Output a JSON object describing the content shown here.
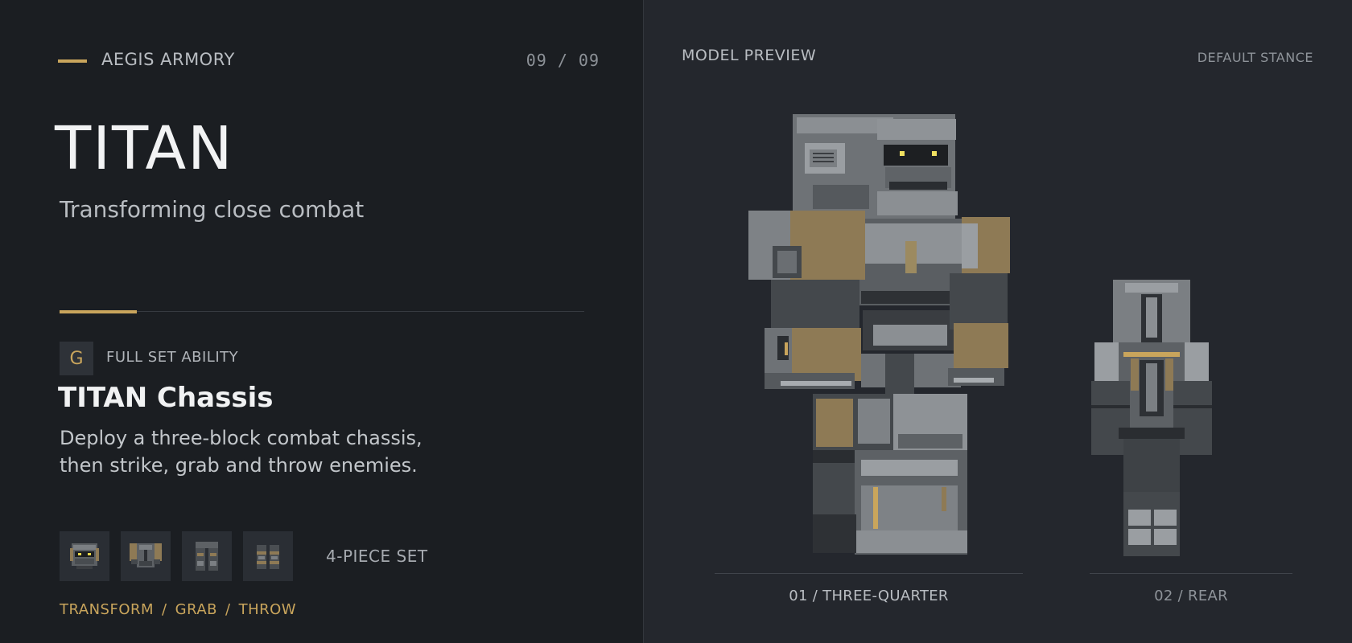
{
  "header": {
    "brand": "AEGIS ARMORY",
    "counter": "09 / 09"
  },
  "hero": {
    "title": "TITAN",
    "subtitle": "Transforming close combat"
  },
  "ability": {
    "key": "G",
    "caption": "FULL SET ABILITY",
    "name": "TITAN Chassis",
    "description": "Deploy a three-block combat chassis, then strike, grab and throw enemies."
  },
  "set": {
    "pieces": [
      "helmet-icon",
      "chestplate-icon",
      "leggings-icon",
      "boots-icon"
    ],
    "label": "4-PIECE SET"
  },
  "tags": [
    "TRANSFORM",
    "GRAB",
    "THROW"
  ],
  "tag_separator": "/",
  "preview": {
    "title": "MODEL PREVIEW",
    "stance": "DEFAULT STANCE",
    "views": [
      {
        "label": "01 / THREE-QUARTER"
      },
      {
        "label": "02 / REAR"
      }
    ]
  },
  "colors": {
    "accent": "#c9a55c",
    "panel_left": "#1b1e22",
    "panel_right": "#24272d"
  }
}
